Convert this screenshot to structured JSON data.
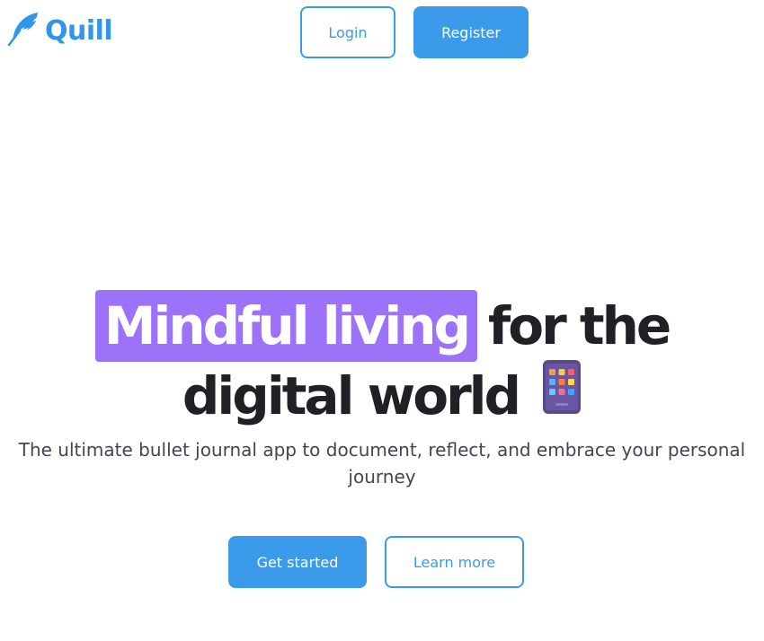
{
  "brand": {
    "name": "Quill",
    "color": "#2f96ea",
    "icon": "feather-icon"
  },
  "nav": {
    "login_label": "Login",
    "register_label": "Register"
  },
  "hero": {
    "highlight_text": "Mindful living",
    "line1_rest": "for the",
    "line2_text": "digital world",
    "emoji_icon": "tablet-emoji-icon",
    "highlight_color": "#9b72f8",
    "subtitle_line1": "The ultimate bullet journal app to document, reflect, and embrace your personal",
    "subtitle_line2": "journey"
  },
  "cta": {
    "get_started_label": "Get started",
    "learn_more_label": "Learn more",
    "accent_color": "#3b9bea"
  }
}
